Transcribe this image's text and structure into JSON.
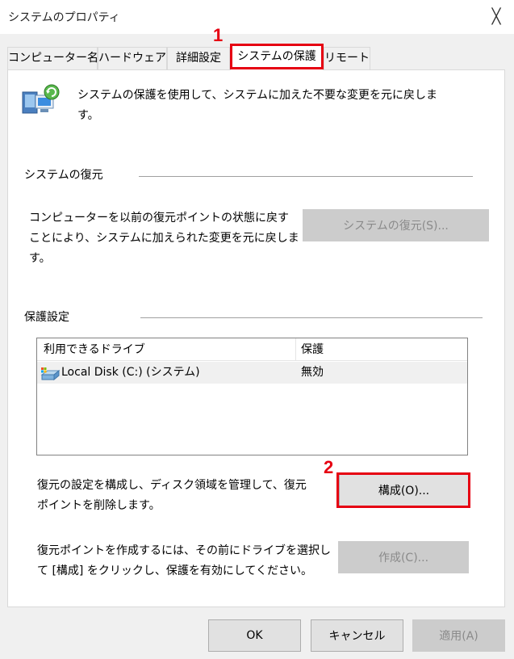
{
  "window": {
    "title": "システムのプロパティ",
    "close_glyph": "╳"
  },
  "tabs": [
    {
      "label": "コンピューター名"
    },
    {
      "label": "ハードウェア"
    },
    {
      "label": "詳細設定"
    },
    {
      "label": "システムの保護"
    },
    {
      "label": "リモート"
    }
  ],
  "callouts": {
    "one": "1",
    "two": "2"
  },
  "intro": {
    "line1": "システムの保護を使用して、システムに加えた不要な変更を元に戻しま",
    "line2": "す。"
  },
  "restore_section": {
    "heading": "システムの復元",
    "line1": "コンピューターを以前の復元ポイントの状態に戻す",
    "line2": "ことにより、システムに加えられた変更を元に戻しま",
    "line3": "す。",
    "button_label": "システムの復元(S)..."
  },
  "protection_section": {
    "heading": "保護設定",
    "columns": {
      "drive": "利用できるドライブ",
      "protection": "保護"
    },
    "rows": [
      {
        "drive": "Local Disk (C:) (システム)",
        "protection": "無効"
      }
    ],
    "configure_line1": "復元の設定を構成し、ディスク領域を管理して、復元",
    "configure_line2": "ポイントを削除します。",
    "configure_button_label": "構成(O)...",
    "create_line1": "復元ポイントを作成するには、その前にドライブを選択し",
    "create_line2": "て [構成] をクリックし、保護を有効にしてください。",
    "create_button_label": "作成(C)..."
  },
  "footer": {
    "ok_label": "OK",
    "cancel_label": "キャンセル",
    "apply_label": "適用(A)"
  },
  "colors": {
    "callout": "#e60012",
    "panel": "#ffffff",
    "background": "#f0f0f0"
  },
  "icons": {
    "header_icon": "system-protection-icon",
    "drive_icon": "local-disk-icon"
  }
}
